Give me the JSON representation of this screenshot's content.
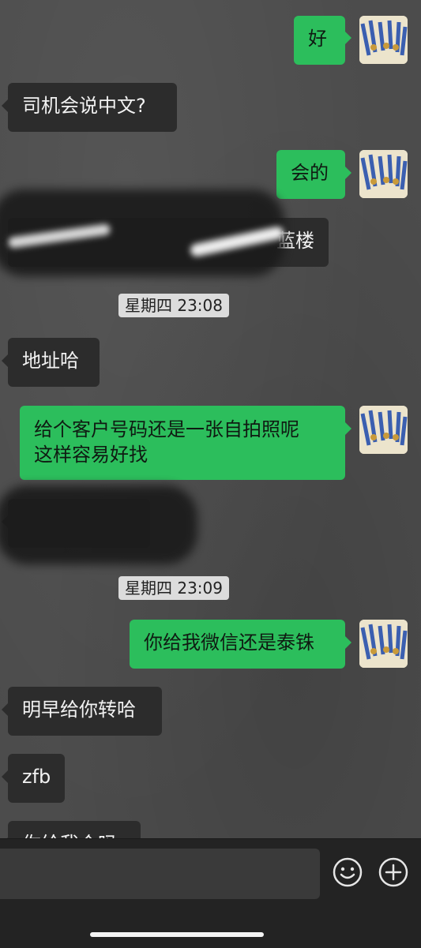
{
  "messages": [
    {
      "side": "out",
      "text": "好"
    },
    {
      "side": "in",
      "text": "司机会说中文?"
    },
    {
      "side": "out",
      "text": "会的"
    },
    {
      "side": "in",
      "text": "蓝楼",
      "redacted": true
    },
    {
      "timestamp": "星期四 23:08"
    },
    {
      "side": "in",
      "text": "地址哈"
    },
    {
      "side": "out",
      "text": "给个客户号码还是一张自拍照呢\n这样容易好找"
    },
    {
      "side": "in",
      "text": "",
      "redacted": true
    },
    {
      "timestamp": "星期四 23:09"
    },
    {
      "side": "out",
      "text": "你给我微信还是泰铢"
    },
    {
      "side": "in",
      "text": "明早给你转哈"
    },
    {
      "side": "in",
      "text": "zfb"
    },
    {
      "side": "in",
      "text": "你给我个吗",
      "partial": true
    }
  ],
  "input_bar": {
    "emoji_icon": "emoji-icon",
    "add_icon": "plus-icon"
  },
  "colors": {
    "incoming_bubble": "#2c2c2c",
    "outgoing_bubble": "#2cbe5c",
    "timestamp_bg": "#dcdcdc"
  }
}
